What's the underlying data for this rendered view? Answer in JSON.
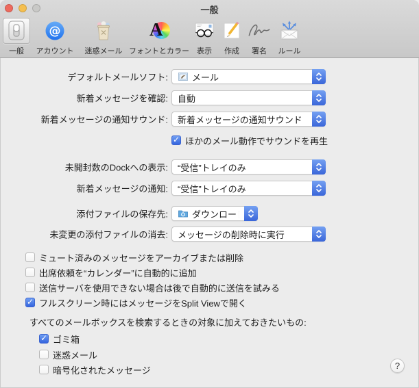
{
  "window": {
    "title": "一般"
  },
  "toolbar": {
    "items": [
      {
        "label": "一般",
        "icon": "general-switch-icon",
        "selected": true
      },
      {
        "label": "アカウント",
        "icon": "accounts-at-icon",
        "selected": false
      },
      {
        "label": "迷惑メール",
        "icon": "junk-trash-icon",
        "selected": false
      },
      {
        "label": "フォントとカラー",
        "icon": "fonts-colors-icon",
        "selected": false
      },
      {
        "label": "表示",
        "icon": "viewing-glasses-icon",
        "selected": false
      },
      {
        "label": "作成",
        "icon": "composing-pencil-icon",
        "selected": false
      },
      {
        "label": "署名",
        "icon": "signature-icon",
        "selected": false
      },
      {
        "label": "ルール",
        "icon": "rules-envelope-icon",
        "selected": false
      }
    ]
  },
  "form": {
    "rows": [
      {
        "label": "デフォルトメールソフト:",
        "value": "メール",
        "icon": "mail-app-icon"
      },
      {
        "label": "新着メッセージを確認:",
        "value": "自動"
      },
      {
        "label": "新着メッセージの通知サウンド:",
        "value": "新着メッセージの通知サウンド"
      },
      {
        "label": "未開封数のDockへの表示:",
        "value": "“受信”トレイのみ"
      },
      {
        "label": "新着メッセージの通知:",
        "value": "“受信”トレイのみ"
      },
      {
        "label": "添付ファイルの保存先:",
        "value": "ダウンロード",
        "icon": "download-folder-icon"
      },
      {
        "label": "未変更の添付ファイルの消去:",
        "value": "メッセージの削除時に実行"
      }
    ],
    "sound_checkbox": {
      "label": "ほかのメール動作でサウンドを再生",
      "checked": true
    },
    "options": [
      {
        "label": "ミュート済みのメッセージをアーカイブまたは削除",
        "checked": false
      },
      {
        "label": "出席依頼を“カレンダー”に自動的に追加",
        "checked": false
      },
      {
        "label": "送信サーバを使用できない場合は後で自動的に送信を試みる",
        "checked": false
      },
      {
        "label": "フルスクリーン時にはメッセージをSplit Viewで開く",
        "checked": true
      }
    ]
  },
  "search": {
    "heading": "すべてのメールボックスを検索するときの対象に加えておきたいもの:",
    "items": [
      {
        "label": "ゴミ箱",
        "checked": true
      },
      {
        "label": "迷惑メール",
        "checked": false
      },
      {
        "label": "暗号化されたメッセージ",
        "checked": false
      }
    ]
  },
  "help": {
    "label": "?"
  },
  "colors": {
    "accent_blue": "#3a66d9",
    "header_gray": "#cdcdcd",
    "content_bg": "#ececec",
    "traffic_red": "#ee6a5e",
    "traffic_yellow": "#f5bf4f",
    "traffic_gray": "#c9c9c7"
  }
}
